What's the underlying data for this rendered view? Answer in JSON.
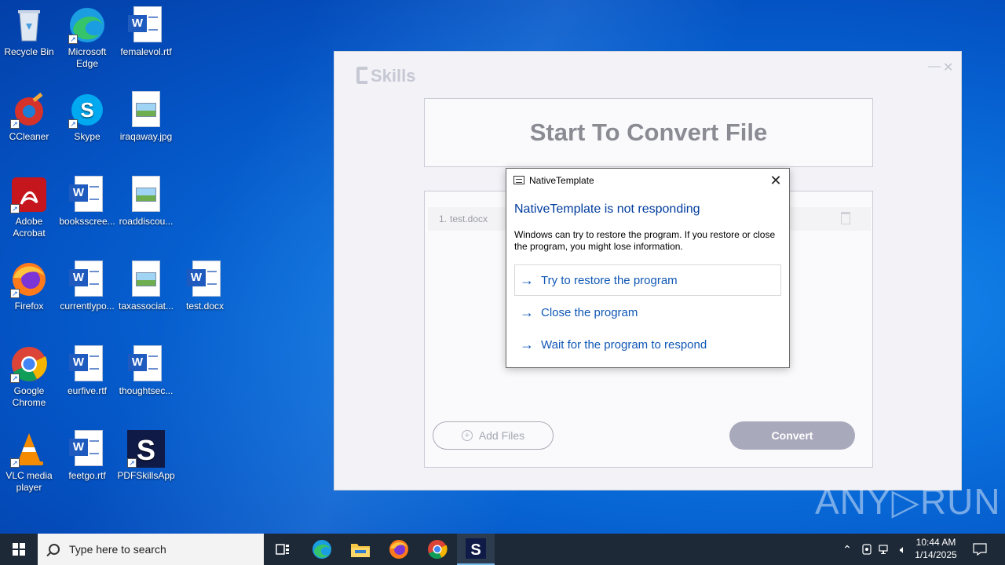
{
  "desktop": {
    "icons": [
      {
        "label": "Recycle Bin",
        "icon": "recycle-bin-icon"
      },
      {
        "label": "Microsoft Edge",
        "icon": "edge-icon"
      },
      {
        "label": "femalevol.rtf",
        "icon": "word-doc-icon"
      },
      {
        "label": "CCleaner",
        "icon": "ccleaner-icon"
      },
      {
        "label": "Skype",
        "icon": "skype-icon"
      },
      {
        "label": "iraqaway.jpg",
        "icon": "image-file-icon"
      },
      {
        "label": "Adobe Acrobat",
        "icon": "acrobat-icon"
      },
      {
        "label": "booksscree...",
        "icon": "word-doc-icon"
      },
      {
        "label": "roaddiscou...",
        "icon": "image-file-icon"
      },
      {
        "label": "Firefox",
        "icon": "firefox-icon"
      },
      {
        "label": "currentlypo...",
        "icon": "word-doc-icon"
      },
      {
        "label": "taxassociat...",
        "icon": "image-file-icon"
      },
      {
        "label": "test.docx",
        "icon": "word-doc-icon"
      },
      {
        "label": "Google Chrome",
        "icon": "chrome-icon"
      },
      {
        "label": "eurfive.rtf",
        "icon": "word-doc-icon"
      },
      {
        "label": "thoughtsec...",
        "icon": "word-doc-icon"
      },
      {
        "label": "VLC media player",
        "icon": "vlc-icon"
      },
      {
        "label": "feetgo.rtf",
        "icon": "word-doc-icon"
      },
      {
        "label": "PDFSkillsApp",
        "icon": "pdfskills-icon"
      }
    ]
  },
  "app": {
    "logo": "Skills",
    "minimize": "—",
    "close": "✕",
    "header": "Start To Convert File",
    "files": [
      {
        "num": "1.",
        "name": "test.docx"
      }
    ],
    "add_files_label": "Add Files",
    "convert_label": "Convert"
  },
  "dialog": {
    "title": "NativeTemplate",
    "heading": "NativeTemplate is not responding",
    "message": "Windows can try to restore the program. If you restore or close the program, you might lose information.",
    "options": [
      "Try to restore the program",
      "Close the program",
      "Wait for the program to respond"
    ]
  },
  "watermark": "ANY▷RUN",
  "taskbar": {
    "search_placeholder": "Type here to search",
    "time": "10:44 AM",
    "date": "1/14/2025"
  },
  "colors": {
    "dialog_link": "#0f57b5",
    "convert_button": "#a8a9bb",
    "taskbar": "#1d2937"
  }
}
